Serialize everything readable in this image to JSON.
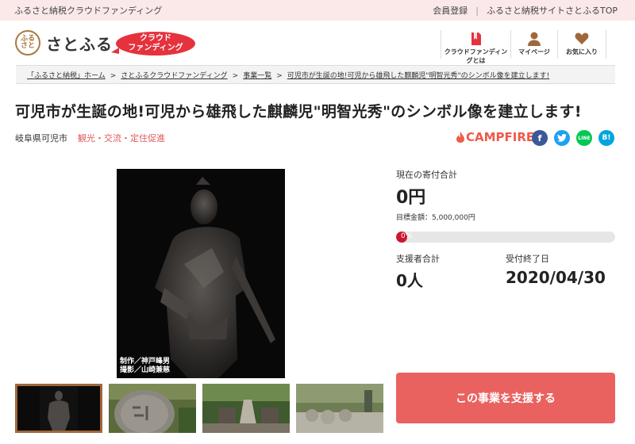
{
  "topbar": {
    "site_name": "ふるさと納税クラウドファンディング",
    "register": "会員登録",
    "top_link": "ふるさと納税サイトさとふるTOP"
  },
  "header": {
    "logo_mark": "さとふる",
    "logo_text": "さとふる",
    "badge_line1": "クラウド",
    "badge_line2": "ファンディング",
    "nav": [
      {
        "icon": "book-icon",
        "label": "クラウドファンディングとは"
      },
      {
        "icon": "user-icon",
        "label": "マイページ"
      },
      {
        "icon": "heart-icon",
        "label": "お気に入り"
      }
    ]
  },
  "breadcrumb": [
    "「ふるさと納税」ホーム",
    "さとふるクラウドファンディング",
    "事業一覧",
    "可児市が生誕の地!可児から雄飛した麒麟児\"明智光秀\"のシンボル像を建立します!"
  ],
  "project": {
    "title": "可児市が生誕の地!可児から雄飛した麒麟児\"明智光秀\"のシンボル像を建立します!",
    "location": "岐阜県可児市",
    "category": "観光・交流・定住促進",
    "image_credit_1": "制作／神戸峰男",
    "image_credit_2": "撮影／山崎兼慈"
  },
  "share": {
    "campfire": "CAMPFIRE",
    "facebook": "f",
    "twitter": "t",
    "line": "LINE",
    "hatena": "B!"
  },
  "stats": {
    "total_label": "現在の寄付合計",
    "total_value": "0円",
    "goal": "目標金額：5,000,000円",
    "progress_pct": "0%",
    "supporters_label": "支援者合計",
    "supporters_value": "0人",
    "deadline_label": "受付終了日",
    "deadline_value": "2020/04/30"
  },
  "cta": {
    "support_label": "この事業を支援する"
  },
  "colors": {
    "accent": "#e5323d",
    "cta": "#e9625f",
    "topbar_bg": "#fbe9ea",
    "facebook": "#3b5998",
    "twitter": "#1da1f2",
    "line": "#06c755",
    "hatena": "#00a4de"
  }
}
